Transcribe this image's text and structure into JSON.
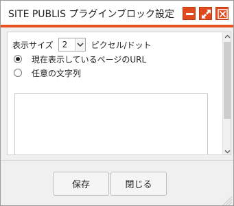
{
  "dialog": {
    "title": "SITE PUBLIS プラグインブロック設定",
    "buttons": {
      "minimize_icon": "minimize-icon",
      "maximize_icon": "maximize-icon",
      "close_icon": "close-icon"
    },
    "accent_color": "#e8531f"
  },
  "form": {
    "size_label": "表示サイズ",
    "size_value": "2",
    "size_unit": "ピクセル/ドット",
    "radio_options": [
      {
        "label": "現在表示しているページのURL",
        "checked": true
      },
      {
        "label": "任意の文字列",
        "checked": false
      }
    ],
    "text_value": ""
  },
  "footer": {
    "save_label": "保存",
    "close_label": "閉じる"
  }
}
